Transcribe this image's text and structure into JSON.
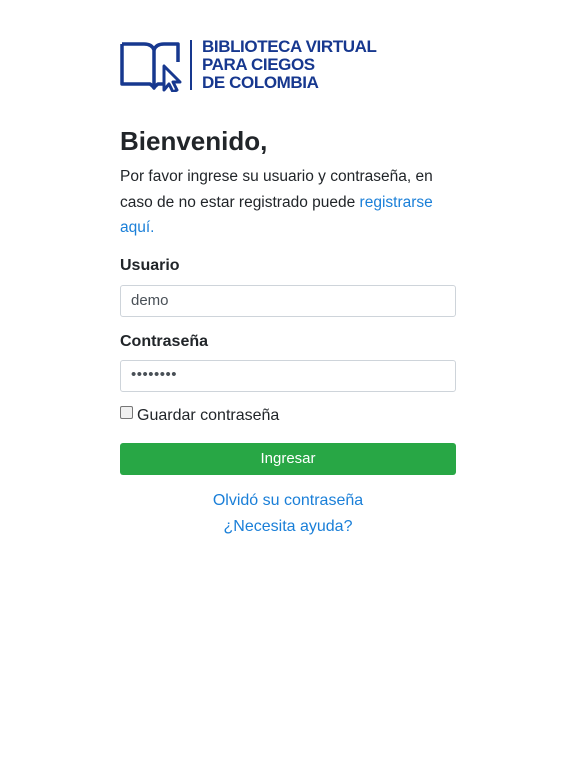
{
  "logo": {
    "line1": "BIBLIOTECA VIRTUAL",
    "line2": "PARA CIEGOS",
    "line3": "DE COLOMBIA",
    "color": "#17388f"
  },
  "welcome": {
    "title": "Bienvenido,",
    "intro_text": "Por favor ingrese su usuario y contraseña, en caso de no estar registrado puede ",
    "register_link": "registrarse aquí."
  },
  "form": {
    "username_label": "Usuario",
    "username_value": "demo",
    "password_label": "Contraseña",
    "password_value": "••••••••",
    "remember_label": "Guardar contraseña",
    "remember_checked": false,
    "submit_label": "Ingresar",
    "submit_color": "#28a745"
  },
  "links": {
    "forgot_password": "Olvidó su contraseña",
    "help": "¿Necesita ayuda?",
    "link_color": "#1a7fd8"
  },
  "icons": [
    "book-cursor-icon"
  ]
}
